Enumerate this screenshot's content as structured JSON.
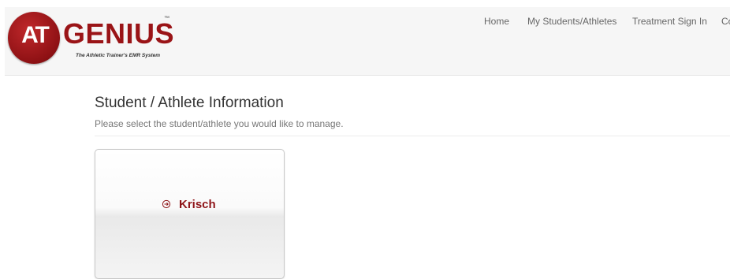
{
  "brand": {
    "logo_mark": "AT",
    "logo_word": "GENIUS",
    "trademark": "™",
    "tagline": "The Athletic Trainer's EMR System",
    "colors": {
      "brand_red": "#9a1417"
    }
  },
  "nav": {
    "items": [
      "Home",
      "My Students/Athletes",
      "Treatment Sign In",
      "Cor"
    ]
  },
  "main": {
    "title": "Student / Athlete Information",
    "subtitle": "Please select the student/athlete you would like to manage."
  },
  "cards": [
    {
      "label": "Krisch",
      "icon": "arrow-circle-right-icon"
    }
  ]
}
